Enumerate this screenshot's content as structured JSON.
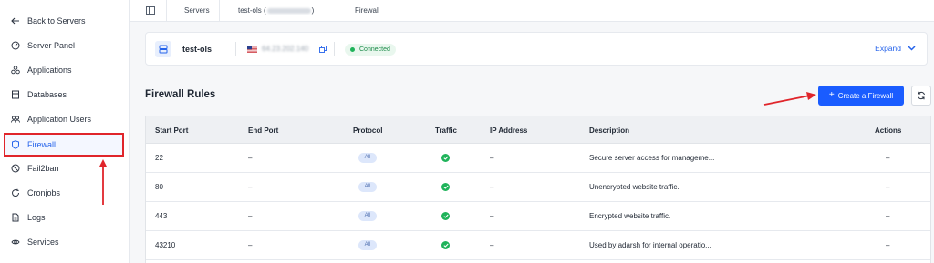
{
  "sidebar": {
    "items": [
      {
        "label": "Back to Servers",
        "icon": "arrow-left-icon"
      },
      {
        "label": "Server Panel",
        "icon": "gauge-icon"
      },
      {
        "label": "Applications",
        "icon": "apps-icon"
      },
      {
        "label": "Databases",
        "icon": "database-icon"
      },
      {
        "label": "Application Users",
        "icon": "users-icon"
      },
      {
        "label": "Firewall",
        "icon": "shield-icon"
      },
      {
        "label": "Fail2ban",
        "icon": "ban-icon"
      },
      {
        "label": "Cronjobs",
        "icon": "refresh-icon"
      },
      {
        "label": "Logs",
        "icon": "file-icon"
      },
      {
        "label": "Services",
        "icon": "services-icon"
      }
    ],
    "active": "Firewall"
  },
  "breadcrumb": {
    "servers": "Servers",
    "server": "test-ols (",
    "server_close": ")",
    "current": "Firewall"
  },
  "server": {
    "name": "test-ols",
    "ip": "64.23.202.140",
    "status": "Connected",
    "expand_label": "Expand"
  },
  "firewall": {
    "title": "Firewall Rules",
    "create_label": "Create a Firewall",
    "columns": [
      "Start Port",
      "End Port",
      "Protocol",
      "Traffic",
      "IP Address",
      "Description",
      "Actions"
    ],
    "rows": [
      {
        "start": "22",
        "end": "–",
        "protocol": "All",
        "ip": "–",
        "description": "Secure server access for manageme...",
        "actions": "–"
      },
      {
        "start": "80",
        "end": "–",
        "protocol": "All",
        "ip": "–",
        "description": "Unencrypted website traffic.",
        "actions": "–"
      },
      {
        "start": "443",
        "end": "–",
        "protocol": "All",
        "ip": "–",
        "description": "Encrypted website traffic.",
        "actions": "–"
      },
      {
        "start": "43210",
        "end": "–",
        "protocol": "All",
        "ip": "–",
        "description": "Used by adarsh for internal operatio...",
        "actions": "–"
      }
    ]
  },
  "colors": {
    "accent": "#2563eb",
    "button": "#1a5cff",
    "success": "#1fb35a",
    "annotation": "#e0252b"
  }
}
